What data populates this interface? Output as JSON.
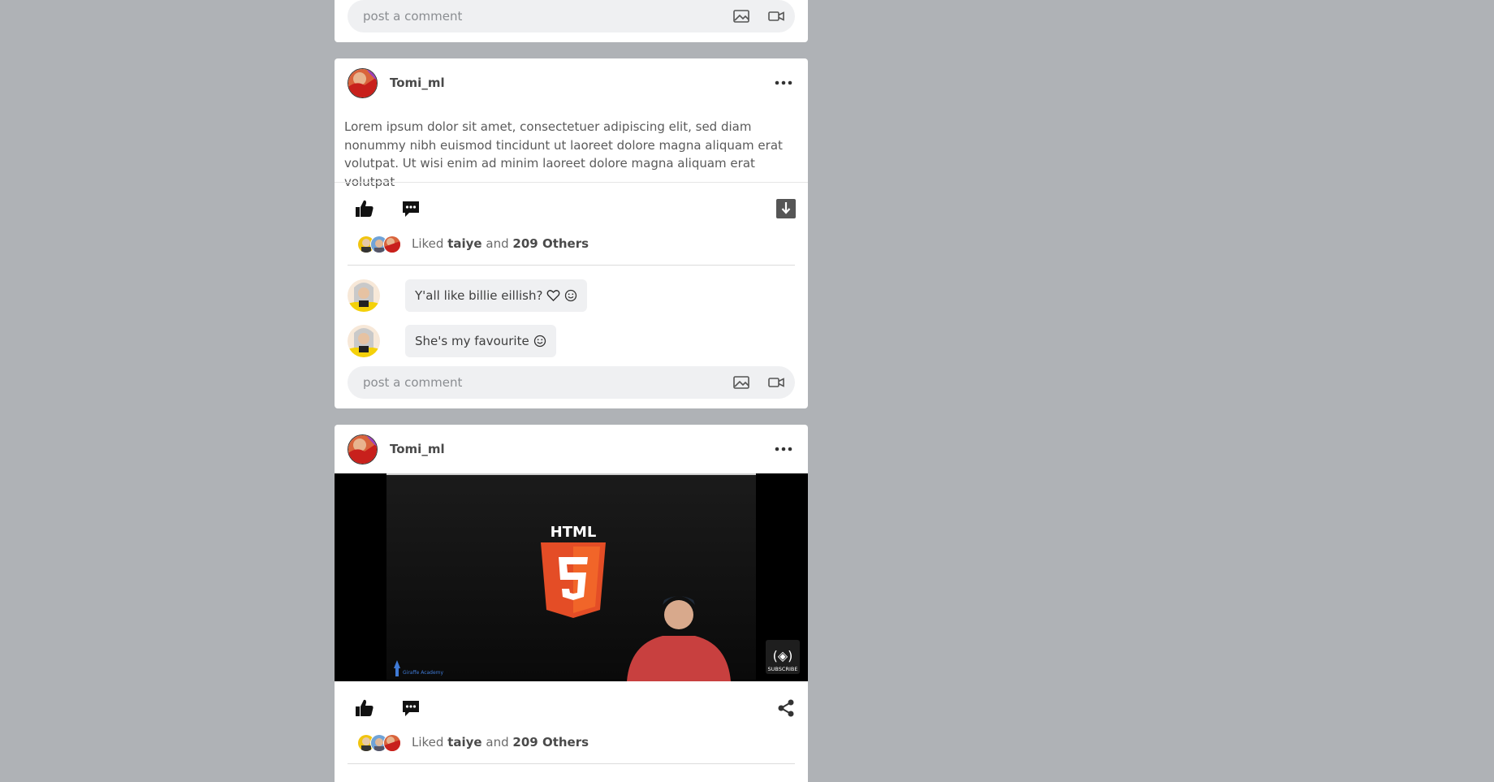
{
  "colors": {
    "page_bg": "#afb2b6",
    "card_bg": "#ffffff",
    "input_bg": "#eff0f2",
    "html5_orange": "#e44d26",
    "video_bg": "#000000"
  },
  "comment_bar": {
    "placeholder": "post a comment",
    "image_icon": "image-icon",
    "video_icon": "video-camera-icon"
  },
  "posts": [
    {
      "username": "Tomi_ml",
      "text": "Lorem ipsum dolor sit amet, consectetuer adipiscing elit, sed diam nonummy nibh euismod tincidunt ut laoreet dolore magna aliquam erat volutpat. Ut wisi enim ad minim laoreet dolore magna aliquam erat volutpat",
      "likes": {
        "prefix": "Liked",
        "name": "taiye",
        "joiner": "and",
        "others": "209 Others"
      },
      "comments": [
        {
          "text": "Y'all like billie eillish?"
        },
        {
          "text": "She's my favourite"
        }
      ]
    },
    {
      "username": "Tomi_ml",
      "video": {
        "heading": "HTML",
        "badge_number": "5",
        "channel": "Giraffe Academy",
        "subscribe": "SUBSCRIBE"
      },
      "likes": {
        "prefix": "Liked",
        "name": "taiye",
        "joiner": "and",
        "others": "209 Others"
      }
    }
  ]
}
